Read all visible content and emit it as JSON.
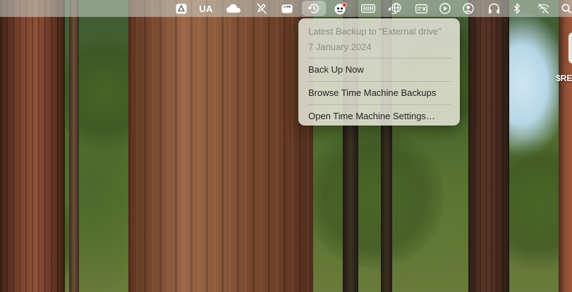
{
  "menubar": {
    "items": [
      {
        "name": "google-drive-icon",
        "icon": "drive"
      },
      {
        "name": "input-source-text",
        "label": "UA"
      },
      {
        "name": "cloud-icon",
        "icon": "cloud"
      },
      {
        "name": "pencil-slash-icon",
        "icon": "pencil-slash"
      },
      {
        "name": "window-icon",
        "icon": "window"
      },
      {
        "name": "time-machine-icon",
        "icon": "clock-arrow",
        "active": true
      },
      {
        "name": "app-face-icon",
        "icon": "face-badge"
      },
      {
        "name": "battery-icon",
        "icon": "battery"
      },
      {
        "name": "globe-hand-icon",
        "icon": "globe"
      },
      {
        "name": "card-icon",
        "icon": "card"
      },
      {
        "name": "play-icon",
        "icon": "play-circle"
      },
      {
        "name": "user-icon",
        "icon": "user-circle"
      },
      {
        "name": "headphones-icon",
        "icon": "headphones"
      },
      {
        "name": "bluetooth-icon",
        "icon": "bluetooth"
      },
      {
        "name": "wifi-off-icon",
        "icon": "wifi-slash"
      },
      {
        "name": "search-icon",
        "icon": "magnifier"
      }
    ],
    "input_source": "UA"
  },
  "time_machine_menu": {
    "latest_backup_label": "Latest Backup to “External drive”",
    "latest_backup_date": "7 January 2024",
    "items": [
      {
        "label": "Back Up Now"
      },
      {
        "label": "Browse Time Machine Backups"
      },
      {
        "label": "Open Time Machine Settings…"
      }
    ]
  },
  "desktop": {
    "partial_widget_text": "$RE"
  }
}
